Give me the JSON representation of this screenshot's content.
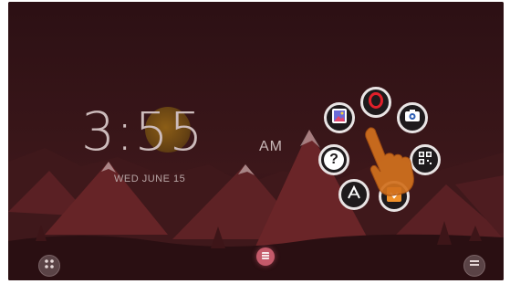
{
  "clock": {
    "time": "3:55",
    "ampm": "AM",
    "date": "WED JUNE 15"
  },
  "quick_launcher": {
    "items": [
      {
        "name": "opera-icon",
        "label": "Opera"
      },
      {
        "name": "gallery-icon",
        "label": "Gallery"
      },
      {
        "name": "camera-icon",
        "label": "Camera"
      },
      {
        "name": "help-icon",
        "label": "?"
      },
      {
        "name": "qr-icon",
        "label": "QR"
      },
      {
        "name": "launcher-a-icon",
        "label": "A"
      },
      {
        "name": "download-icon",
        "label": "Download"
      }
    ]
  },
  "bottom_bar": {
    "left": "apps-grid-icon",
    "center": "home-icon",
    "right": "menu-icon"
  },
  "colors": {
    "accent": "#c45a6a",
    "hand": "#d2711e",
    "opera_red": "#e0202a"
  }
}
